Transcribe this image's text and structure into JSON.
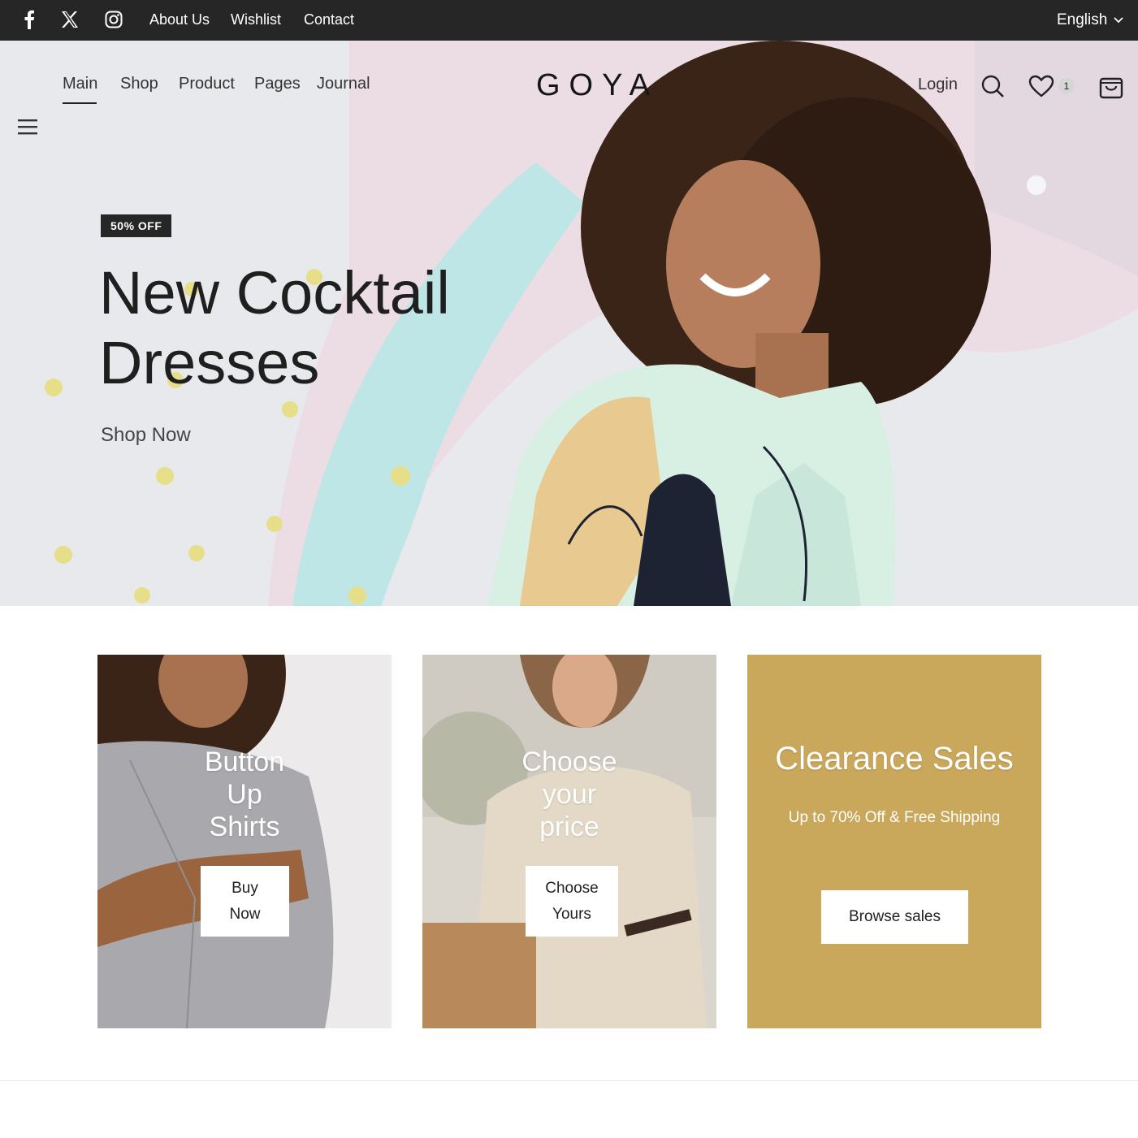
{
  "topbar": {
    "social": [
      "facebook-icon",
      "x-twitter-icon",
      "instagram-icon"
    ],
    "links": [
      "About Us",
      "Wishlist",
      "Contact"
    ],
    "language": "English"
  },
  "nav": {
    "links": [
      "Main",
      "Shop",
      "Product",
      "Pages",
      "Journal"
    ],
    "active": "Main",
    "logo": "GOYA",
    "login": "Login",
    "wishlist_count": "1"
  },
  "hero": {
    "tag": "50% OFF",
    "title_line1": "New Cocktail",
    "title_line2": "Dresses",
    "cta": "Shop Now"
  },
  "cards": [
    {
      "title_lines": [
        "Button",
        "Up",
        "Shirts"
      ],
      "button_lines": [
        "Buy",
        "Now"
      ]
    },
    {
      "title_lines": [
        "Choose",
        "your",
        "price"
      ],
      "button_lines": [
        "Choose",
        "Yours"
      ]
    },
    {
      "title": "Clearance Sales",
      "subtitle": "Up to 70% Off & Free Shipping",
      "button": "Browse sales"
    }
  ],
  "colors": {
    "topbar": "#262626",
    "clearance_card": "#c9a85c",
    "text_dark": "#1f1f1f"
  }
}
